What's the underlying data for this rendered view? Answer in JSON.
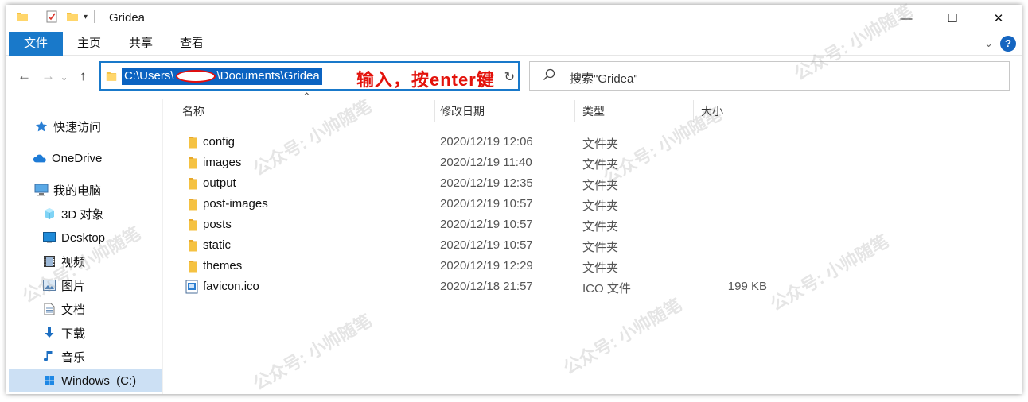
{
  "titlebar": {
    "title": "Gridea",
    "controls": {
      "minimize": "—",
      "maximize": "☐",
      "close": "✕"
    }
  },
  "ribbon": {
    "tabs": [
      {
        "label": "文件"
      },
      {
        "label": "主页"
      },
      {
        "label": "共享"
      },
      {
        "label": "查看"
      }
    ]
  },
  "address": {
    "path_prefix": "C:\\Users\\",
    "path_suffix": "\\Documents\\Gridea"
  },
  "annotation": "输入，按enter键",
  "search": {
    "placeholder": "搜索\"Gridea\""
  },
  "sidebar": {
    "items": [
      {
        "label": "快速访问",
        "icon": "star-icon"
      },
      {
        "label": "OneDrive",
        "icon": "cloud-icon"
      },
      {
        "label": "我的电脑",
        "icon": "computer-icon"
      },
      {
        "label": "3D 对象",
        "icon": "cube-icon"
      },
      {
        "label": "Desktop",
        "icon": "desktop-icon"
      },
      {
        "label": "视频",
        "icon": "video-icon"
      },
      {
        "label": "图片",
        "icon": "picture-icon"
      },
      {
        "label": "文档",
        "icon": "document-icon"
      },
      {
        "label": "下载",
        "icon": "download-icon"
      },
      {
        "label": "音乐",
        "icon": "music-icon"
      },
      {
        "label": "Windows  (C:)",
        "icon": "drive-icon"
      }
    ]
  },
  "columns": {
    "name": "名称",
    "date": "修改日期",
    "type": "类型",
    "size": "大小"
  },
  "files": [
    {
      "name": "config",
      "date": "2020/12/19 12:06",
      "type": "文件夹",
      "size": "",
      "kind": "folder"
    },
    {
      "name": "images",
      "date": "2020/12/19 11:40",
      "type": "文件夹",
      "size": "",
      "kind": "folder"
    },
    {
      "name": "output",
      "date": "2020/12/19 12:35",
      "type": "文件夹",
      "size": "",
      "kind": "folder"
    },
    {
      "name": "post-images",
      "date": "2020/12/19 10:57",
      "type": "文件夹",
      "size": "",
      "kind": "folder"
    },
    {
      "name": "posts",
      "date": "2020/12/19 10:57",
      "type": "文件夹",
      "size": "",
      "kind": "folder"
    },
    {
      "name": "static",
      "date": "2020/12/19 10:57",
      "type": "文件夹",
      "size": "",
      "kind": "folder"
    },
    {
      "name": "themes",
      "date": "2020/12/19 12:29",
      "type": "文件夹",
      "size": "",
      "kind": "folder"
    },
    {
      "name": "favicon.ico",
      "date": "2020/12/18 21:57",
      "type": "ICO 文件",
      "size": "199 KB",
      "kind": "file"
    }
  ],
  "watermark": "公众号: 小帅随笔",
  "colors": {
    "accent": "#1979ca",
    "selection": "#0b63c1",
    "annotation": "#e3120b",
    "folder": "#f5c242"
  }
}
